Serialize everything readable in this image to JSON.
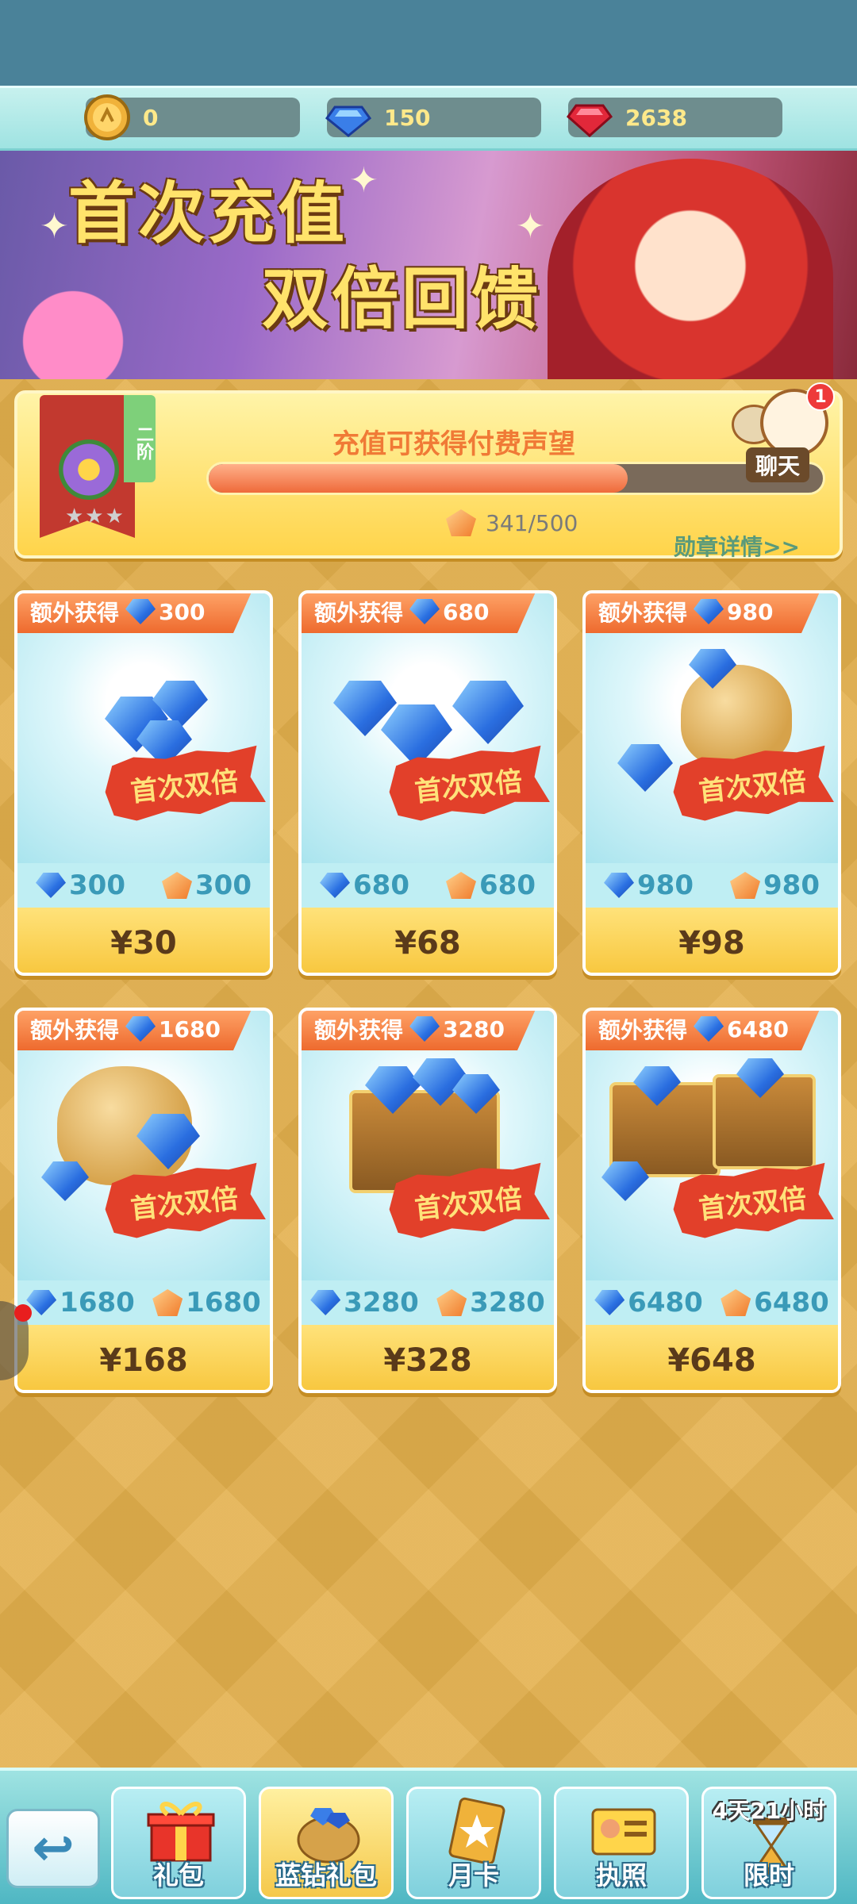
{
  "currency": {
    "gold": "0",
    "diamond": "150",
    "ruby": "2638"
  },
  "banner": {
    "line1": "首次充值",
    "line2": "双倍回馈"
  },
  "reputation": {
    "rank_tag": "二阶",
    "title": "充值可获得付费声望",
    "current": 341,
    "max": 500,
    "count_text": "341/500",
    "progress_fraction": 0.682,
    "detail_link": "勋章详情>>",
    "chat_label": "聊天",
    "chat_badge": "1"
  },
  "products": [
    {
      "bonus_label": "额外获得",
      "bonus": "300",
      "tag": "首次双倍",
      "diamonds": "300",
      "reputation": "300",
      "price": "¥30"
    },
    {
      "bonus_label": "额外获得",
      "bonus": "680",
      "tag": "首次双倍",
      "diamonds": "680",
      "reputation": "680",
      "price": "¥68"
    },
    {
      "bonus_label": "额外获得",
      "bonus": "980",
      "tag": "首次双倍",
      "diamonds": "980",
      "reputation": "980",
      "price": "¥98"
    },
    {
      "bonus_label": "额外获得",
      "bonus": "1680",
      "tag": "首次双倍",
      "diamonds": "1680",
      "reputation": "1680",
      "price": "¥168"
    },
    {
      "bonus_label": "额外获得",
      "bonus": "3280",
      "tag": "首次双倍",
      "diamonds": "3280",
      "reputation": "3280",
      "price": "¥328"
    },
    {
      "bonus_label": "额外获得",
      "bonus": "6480",
      "tag": "首次双倍",
      "diamonds": "6480",
      "reputation": "6480",
      "price": "¥648"
    }
  ],
  "nav": {
    "back": "back-arrow-icon",
    "items": [
      {
        "label": "礼包",
        "icon": "gift-box-icon"
      },
      {
        "label": "蓝钻礼包",
        "icon": "diamond-sack-icon"
      },
      {
        "label": "月卡",
        "icon": "month-card-icon"
      },
      {
        "label": "执照",
        "icon": "license-icon"
      },
      {
        "label": "限时",
        "icon": "hourglass-icon",
        "timer": "4天21小时"
      }
    ]
  },
  "colors": {
    "accent_orange": "#ee6a2e",
    "diamond_blue": "#2a70e2",
    "panel_gold": "#ffd44a"
  }
}
